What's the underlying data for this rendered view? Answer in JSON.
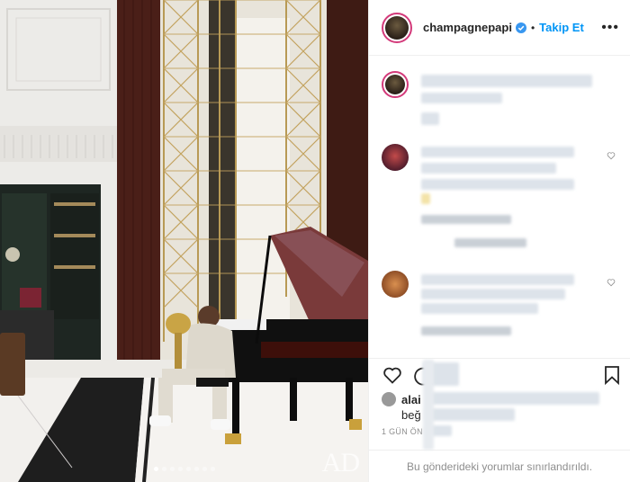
{
  "post": {
    "username": "champagnepapi",
    "separator": "•",
    "follow_label": "Takip Et",
    "more_label": "•••",
    "watermark": "AD",
    "carousel_dots": 8,
    "carousel_active": 0,
    "liked_by_prefix": "alai",
    "liked_by_suffix": "beğ",
    "timestamp": "1 GÜN ÖN",
    "comments_limited": "Bu gönderideki yorumlar sınırlandırıldı."
  },
  "icons": {
    "verified": "verified-badge-icon",
    "like": "heart-icon",
    "comment": "comment-icon",
    "save": "bookmark-icon",
    "more": "more-options-icon"
  },
  "colors": {
    "follow": "#0095f6",
    "verified": "#3897f0",
    "story_ring": "#d33a7a",
    "muted": "#8e8e8e",
    "text": "#262626"
  }
}
